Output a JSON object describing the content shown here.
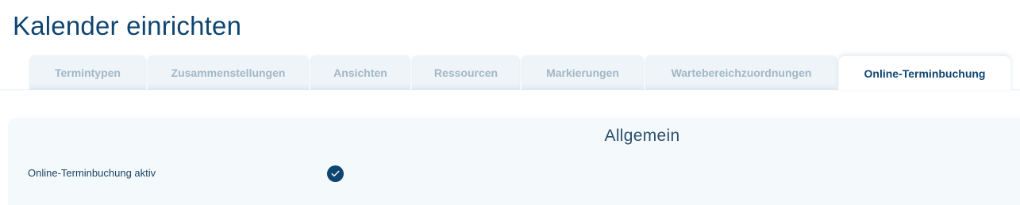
{
  "page": {
    "title": "Kalender einrichten"
  },
  "tabs": [
    {
      "label": "Termintypen",
      "active": false
    },
    {
      "label": "Zusammenstellungen",
      "active": false
    },
    {
      "label": "Ansichten",
      "active": false
    },
    {
      "label": "Ressourcen",
      "active": false
    },
    {
      "label": "Markierungen",
      "active": false
    },
    {
      "label": "Wartebereichzuordnungen",
      "active": false
    },
    {
      "label": "Online-Terminbuchung",
      "active": true
    }
  ],
  "section": {
    "title": "Allgemein",
    "fields": [
      {
        "label": "Online-Terminbuchung aktiv",
        "checked": true
      }
    ]
  },
  "colors": {
    "primary": "#0f4571",
    "tab_inactive_text": "#a3b7c6",
    "tab_inactive_bg": "#eef4f8",
    "panel_bg": "#f4f9fc"
  },
  "icons": {
    "checkbox": "check-circle-icon"
  }
}
